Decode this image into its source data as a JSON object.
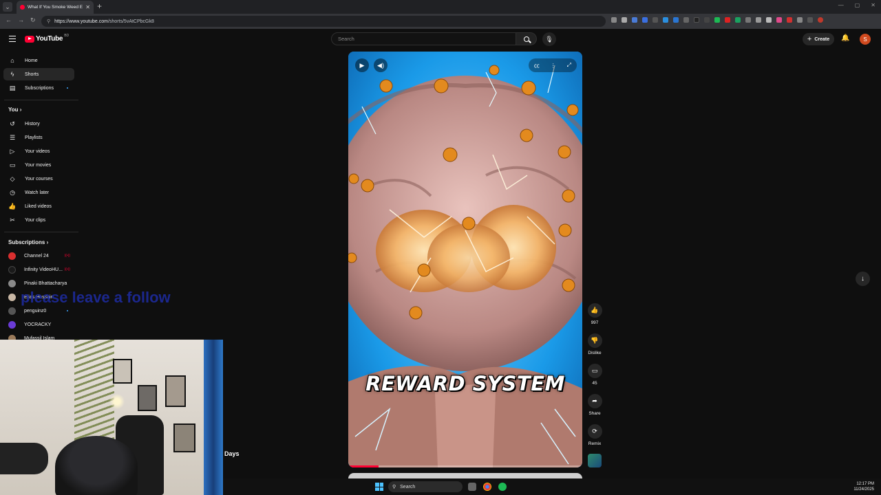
{
  "browser": {
    "tab_title": "What If You Smoke Weed Every",
    "new_tab": "+",
    "url_domain": "https://www.youtube.com",
    "url_path": "/shorts/5vAtCPbcGk8"
  },
  "masthead": {
    "logo_text": "YouTube",
    "country_code": "BD",
    "search_placeholder": "Search",
    "create_label": "Create",
    "avatar_initial": "S"
  },
  "sidebar": {
    "main": [
      {
        "label": "Home",
        "icon": "home-icon"
      },
      {
        "label": "Shorts",
        "icon": "shorts-icon"
      },
      {
        "label": "Subscriptions",
        "icon": "subscriptions-icon"
      }
    ],
    "you_title": "You",
    "you": [
      {
        "label": "History",
        "icon": "history-icon"
      },
      {
        "label": "Playlists",
        "icon": "playlists-icon"
      },
      {
        "label": "Your videos",
        "icon": "your-videos-icon"
      },
      {
        "label": "Your movies",
        "icon": "movies-icon"
      },
      {
        "label": "Your courses",
        "icon": "courses-icon"
      },
      {
        "label": "Watch later",
        "icon": "watch-later-icon"
      },
      {
        "label": "Liked videos",
        "icon": "liked-icon"
      },
      {
        "label": "Your clips",
        "icon": "clips-icon"
      }
    ],
    "subs_title": "Subscriptions",
    "subscriptions": [
      {
        "label": "Channel 24",
        "color": "#d92f2f"
      },
      {
        "label": "Infinity VideoHU...",
        "color": "#1a1a1a"
      },
      {
        "label": "Pinaki Bhattacharya",
        "color": "#8a8a8a"
      },
      {
        "label": "Elias Hossain",
        "color": "#c9b8a5"
      },
      {
        "label": "penguinz0",
        "color": "#555555"
      },
      {
        "label": "YOCRACKY",
        "color": "#6a3bd6"
      },
      {
        "label": "Mufassil Islam",
        "color": "#9a7a5a"
      }
    ]
  },
  "overlay_text": "please leave a follow",
  "webcam_caption": "Days",
  "player": {
    "caption": "REWARD SYSTEM",
    "progress": 0.13
  },
  "actions": {
    "likes": "997",
    "dislike": "Dislike",
    "comments": "45",
    "share": "Share",
    "remix": "Remix"
  },
  "taskbar": {
    "search": "Search",
    "time": "12:17 PM",
    "date": "11/24/2025"
  }
}
